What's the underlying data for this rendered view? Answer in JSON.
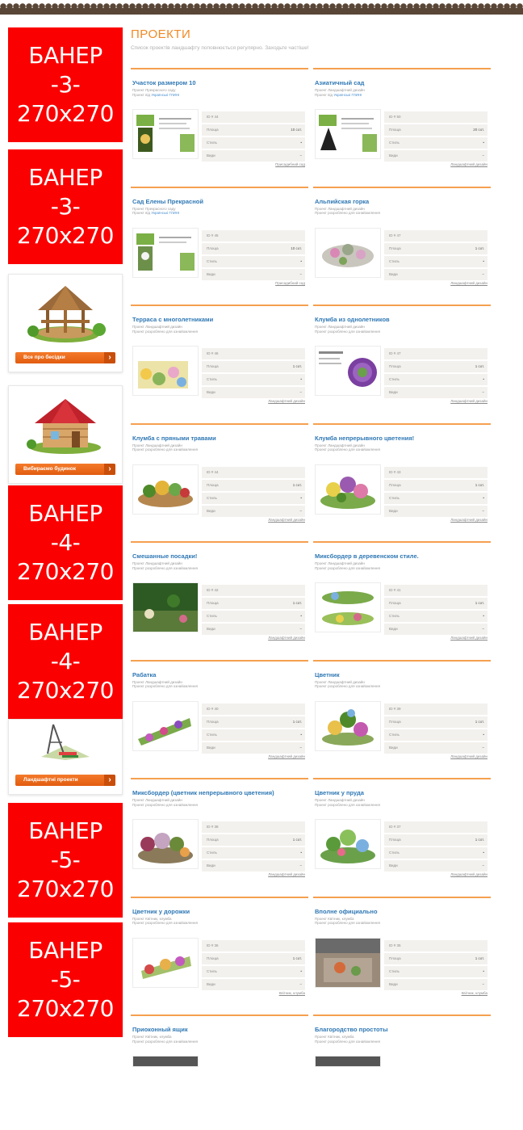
{
  "page": {
    "title": "ПРОЕКТИ",
    "subtitle": "Список проектів ландшафту поповнюється регулярно. Заходьте частіше!"
  },
  "sidebar": {
    "banners": [
      {
        "l1": "БАНЕР",
        "l2": "-3-",
        "l3": "270x270"
      },
      {
        "l1": "БАНЕР",
        "l2": "-3-",
        "l3": "270x270"
      },
      {
        "l1": "БАНЕР",
        "l2": "-4-",
        "l3": "270x270"
      },
      {
        "l1": "БАНЕР",
        "l2": "-4-",
        "l3": "270x270"
      },
      {
        "l1": "БАНЕР",
        "l2": "-5-",
        "l3": "270x270"
      },
      {
        "l1": "БАНЕР",
        "l2": "-5-",
        "l3": "270x270"
      }
    ],
    "promos": [
      {
        "label": "Все про бесідки",
        "icon": "gazebo-icon"
      },
      {
        "label": "Вибираємо будинок",
        "icon": "house-icon"
      },
      {
        "label": "Ландшафтні проекти",
        "icon": "landscape-icon"
      }
    ]
  },
  "spec_labels": {
    "id": "ID #",
    "area": "Площа",
    "style": "Стиль",
    "type": "Види"
  },
  "projects": [
    {
      "title": "Участок размером 10",
      "m1": "Проект Прекрасного саду",
      "m2": "Проект від",
      "link": "Українські ГЛИНІ",
      "id": "ID # 44",
      "area": "10 сот.",
      "cat": "Присадибний сад"
    },
    {
      "title": "Азиатичный сад",
      "m1": "Проект Ландшафтний дизайн",
      "m2": "Проект від",
      "link": "Українські ГЛИНІ",
      "id": "ID # 50",
      "area": "20 сот.",
      "cat": "Ландшафтний дизайн"
    },
    {
      "title": "Сад Елены Прекрасной",
      "m1": "Проект Прекрасного саду",
      "m2": "Проект від",
      "link": "Українські ГЛИНІ",
      "id": "ID # 45",
      "area": "10 сот.",
      "cat": "Присадибний сад"
    },
    {
      "title": "Альпийская горка",
      "m1": "Проект Ландшафтний дизайн",
      "m2": "Проект розроблено для ознайомлення",
      "link": "",
      "id": "ID # 47",
      "area": "1 сот.",
      "cat": "Ландшафтний дизайн"
    },
    {
      "title": "Терраса с многолетниками",
      "m1": "Проект Ландшафтний дизайн",
      "m2": "Проект розроблено для ознайомлення",
      "link": "",
      "id": "ID # 46",
      "area": "1 сот.",
      "cat": "Ландшафтний дизайн"
    },
    {
      "title": "Клумба из однолетников",
      "m1": "Проект Ландшафтний дизайн",
      "m2": "Проект розроблено для ознайомлення",
      "link": "",
      "id": "ID # 47",
      "area": "1 сот.",
      "cat": "Ландшафтний дизайн"
    },
    {
      "title": "Клумба с пряными травами",
      "m1": "Проект Ландшафтний дизайн",
      "m2": "Проект розроблено для ознайомлення",
      "link": "",
      "id": "ID # 44",
      "area": "1 сот.",
      "cat": "Ландшафтний дизайн"
    },
    {
      "title": "Клумба непрерывного цветения!",
      "m1": "Проект Ландшафтний дизайн",
      "m2": "Проект розроблено для ознайомлення",
      "link": "",
      "id": "ID # 43",
      "area": "1 сот.",
      "cat": "Ландшафтний дизайн"
    },
    {
      "title": "Смешанные посадки!",
      "m1": "Проект Ландшафтний дизайн",
      "m2": "Проект розроблено для ознайомлення",
      "link": "",
      "id": "ID # 42",
      "area": "1 сот.",
      "cat": "Ландшафтний дизайн"
    },
    {
      "title": "Миксбордер в деревенском стиле.",
      "m1": "Проект Ландшафтний дизайн",
      "m2": "Проект розроблено для ознайомлення",
      "link": "",
      "id": "ID # 41",
      "area": "1 сот.",
      "cat": "Ландшафтний дизайн"
    },
    {
      "title": "Рабатка",
      "m1": "Проект Ландшафтний дизайн",
      "m2": "Проект розроблено для ознайомлення",
      "link": "",
      "id": "ID # 40",
      "area": "1 сот.",
      "cat": "Ландшафтний дизайн"
    },
    {
      "title": "Цветник",
      "m1": "Проект Ландшафтний дизайн",
      "m2": "Проект розроблено для ознайомлення",
      "link": "",
      "id": "ID # 39",
      "area": "1 сот.",
      "cat": "Ландшафтний дизайн"
    },
    {
      "title": "Миксбордер (цветник непрерывного цветения)",
      "m1": "Проект Ландшафтний дизайн",
      "m2": "Проект розроблено для ознайомлення",
      "link": "",
      "id": "ID # 38",
      "area": "1 сот.",
      "cat": "Ландшафтний дизайн"
    },
    {
      "title": "Цветник у пруда",
      "m1": "Проект Ландшафтний дизайн",
      "m2": "Проект розроблено для ознайомлення",
      "link": "",
      "id": "ID # 37",
      "area": "1 сот.",
      "cat": "Ландшафтний дизайн"
    },
    {
      "title": "Цветник у дорожки",
      "m1": "Проект Квітник, клумба",
      "m2": "Проект розроблено для ознайомлення",
      "link": "",
      "id": "ID # 36",
      "area": "1 сот.",
      "cat": "Квітник, клумба"
    },
    {
      "title": "Вполне официально",
      "m1": "Проект Квітник, клумба",
      "m2": "Проект розроблено для ознайомлення",
      "link": "",
      "id": "ID # 35",
      "area": "1 сот.",
      "cat": "Квітник, клумба"
    },
    {
      "title": "Приоконный ящик",
      "m1": "Проект Квітник, клумба",
      "m2": "Проект розроблено для ознайомлення",
      "link": "",
      "id": "",
      "area": "",
      "cat": ""
    },
    {
      "title": "Благородство простоты",
      "m1": "Проект Квітник, клумба",
      "m2": "Проект розроблено для ознайомлення",
      "link": "",
      "id": "",
      "area": "",
      "cat": ""
    }
  ],
  "colors": {
    "accent": "#f08a24",
    "banner": "#fb0000",
    "link": "#2f78b4",
    "border": "#5a4636"
  }
}
